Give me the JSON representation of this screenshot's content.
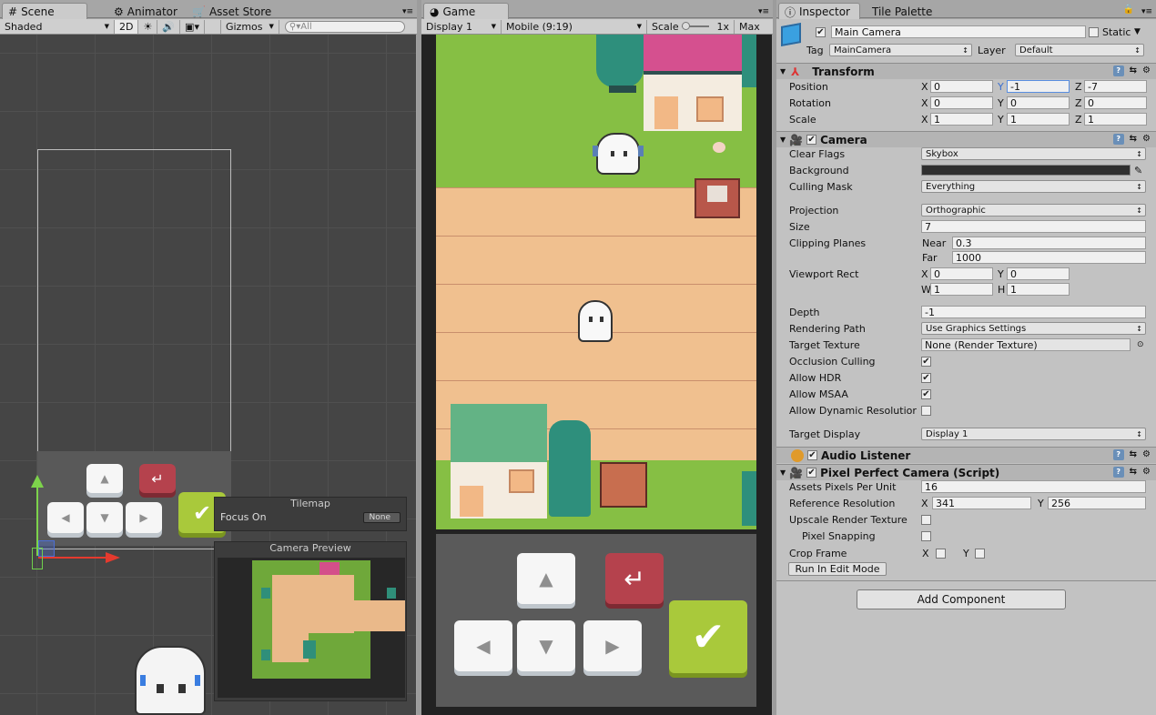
{
  "scene_panel": {
    "tabs": [
      {
        "label": "Scene",
        "icon": "hash-icon"
      },
      {
        "label": "Animator",
        "icon": "animator-icon"
      },
      {
        "label": "Asset Store",
        "icon": "store-icon"
      }
    ],
    "toolbar": {
      "shading": "Shaded",
      "mode_2d": "2D",
      "gizmos": "Gizmos",
      "search_placeholder": "All"
    },
    "tilemap_overlay": {
      "title": "Tilemap",
      "focus_label": "Focus On",
      "focus_value": "None"
    },
    "camera_preview": {
      "title": "Camera Preview"
    }
  },
  "game_panel": {
    "tab": "Game",
    "display": "Display 1",
    "aspect": "Mobile (9:19)",
    "scale_label": "Scale",
    "scale_value": "1x",
    "maximize": "Max"
  },
  "inspector": {
    "tabs": [
      {
        "label": "Inspector"
      },
      {
        "label": "Tile Palette"
      }
    ],
    "object_name": "Main Camera",
    "static_label": "Static",
    "tag_label": "Tag",
    "tag_value": "MainCamera",
    "layer_label": "Layer",
    "layer_value": "Default",
    "transform": {
      "title": "Transform",
      "position": {
        "label": "Position",
        "x": "0",
        "y": "-1",
        "z": "-7"
      },
      "rotation": {
        "label": "Rotation",
        "x": "0",
        "y": "0",
        "z": "0"
      },
      "scale": {
        "label": "Scale",
        "x": "1",
        "y": "1",
        "z": "1"
      }
    },
    "camera": {
      "title": "Camera",
      "clear_flags": {
        "label": "Clear Flags",
        "value": "Skybox"
      },
      "background": {
        "label": "Background",
        "color": "#2f2f2f"
      },
      "culling_mask": {
        "label": "Culling Mask",
        "value": "Everything"
      },
      "projection": {
        "label": "Projection",
        "value": "Orthographic"
      },
      "size": {
        "label": "Size",
        "value": "7"
      },
      "clipping": {
        "label": "Clipping Planes",
        "near_label": "Near",
        "near": "0.3",
        "far_label": "Far",
        "far": "1000"
      },
      "viewport": {
        "label": "Viewport Rect",
        "x": "0",
        "y": "0",
        "w": "1",
        "h": "1"
      },
      "depth": {
        "label": "Depth",
        "value": "-1"
      },
      "rendering_path": {
        "label": "Rendering Path",
        "value": "Use Graphics Settings"
      },
      "target_texture": {
        "label": "Target Texture",
        "value": "None (Render Texture)"
      },
      "occlusion": {
        "label": "Occlusion Culling",
        "checked": true
      },
      "hdr": {
        "label": "Allow HDR",
        "checked": true
      },
      "msaa": {
        "label": "Allow MSAA",
        "checked": true
      },
      "dynres": {
        "label": "Allow Dynamic Resolutior",
        "checked": false
      },
      "target_display": {
        "label": "Target Display",
        "value": "Display 1"
      }
    },
    "audio_listener": {
      "title": "Audio Listener"
    },
    "pixel_perfect": {
      "title": "Pixel Perfect Camera (Script)",
      "ppu": {
        "label": "Assets Pixels Per Unit",
        "value": "16"
      },
      "ref_res": {
        "label": "Reference Resolution",
        "x": "341",
        "y": "256"
      },
      "upscale": {
        "label": "Upscale Render Texture"
      },
      "snapping": {
        "label": "Pixel Snapping"
      },
      "crop": {
        "label": "Crop Frame"
      },
      "run_button": "Run In Edit Mode"
    },
    "add_component": "Add Component"
  },
  "axes": {
    "x": "X",
    "y": "Y",
    "z": "Z",
    "w": "W",
    "h": "H"
  }
}
